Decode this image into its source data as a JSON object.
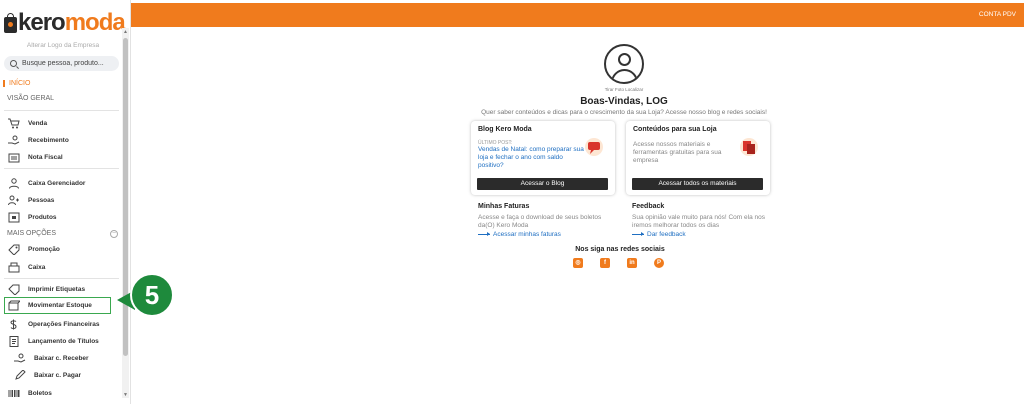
{
  "brand": {
    "word1": "kero",
    "word2": "moda",
    "alter_logo": "Alterar Logo da Empresa"
  },
  "search": {
    "placeholder": "Busque pessoa, produto..."
  },
  "colors": {
    "accent": "#f07b1d",
    "dark": "#2b2b2b",
    "link": "#1f6fc2",
    "highlight": "#3aa84f",
    "badge": "#1e8a3c"
  },
  "sidebar": {
    "inicio": "INÍCIO",
    "visao_geral": "VISÃO GERAL",
    "mais_opcoes": "MAIS OPÇÕES",
    "items": [
      {
        "label": "Venda",
        "icon": "cart-icon"
      },
      {
        "label": "Recebimento",
        "icon": "hand-coin-icon"
      },
      {
        "label": "Nota Fiscal",
        "icon": "invoice-icon"
      },
      {
        "label": "Caixa Gerenciador",
        "icon": "person-icon"
      },
      {
        "label": "Pessoas",
        "icon": "people-icon"
      },
      {
        "label": "Produtos",
        "icon": "box-icon"
      },
      {
        "label": "Promoção",
        "icon": "tag-icon"
      },
      {
        "label": "Caixa",
        "icon": "cash-register-icon"
      },
      {
        "label": "Imprimir Etiquetas",
        "icon": "label-icon"
      },
      {
        "label": "Movimentar Estoque",
        "icon": "stock-icon"
      },
      {
        "label": "Operações Financeiras",
        "icon": "dollar-icon"
      },
      {
        "label": "Lançamento de Títulos",
        "icon": "document-icon"
      },
      {
        "label": "Baixar c. Receber",
        "icon": "hand-coin-icon"
      },
      {
        "label": "Baixar c. Pagar",
        "icon": "pen-icon"
      },
      {
        "label": "Boletos",
        "icon": "barcode-icon"
      }
    ]
  },
  "step_badge": "5",
  "topbar": {
    "account": "CONTA PDV"
  },
  "main": {
    "photo_actions": "Tirar Foto  Localizar",
    "welcome": "Boas-Vindas, LOG",
    "subtitle": "Quer saber conteúdos e dicas para o crescimento da sua Loja? Acesse nosso blog e redes sociais!",
    "blog": {
      "title": "Blog Kero Moda",
      "ultimo": "ÚLTIMO POST:",
      "post": "Vendas de Natal: como preparar sua loja e fechar o ano com saldo positivo?",
      "button": "Acessar o Blog"
    },
    "conteudos": {
      "title": "Conteúdos para sua Loja",
      "desc": "Acesse nossos materiais e ferramentas gratuitas para sua empresa",
      "button": "Acessar todos os materiais"
    },
    "faturas": {
      "title": "Minhas Faturas",
      "desc": "Acesse e faça o download de seus boletos da(O) Kero Moda",
      "link": "Acessar minhas faturas"
    },
    "feedback": {
      "title": "Feedback",
      "desc": "Sua opinião vale muito para nós! Com ela nos iremos melhorar todos os dias",
      "link": "Dar feedback"
    },
    "social_title": "Nos siga nas redes sociais",
    "social": [
      {
        "name": "instagram-icon",
        "glyph": "◎"
      },
      {
        "name": "facebook-icon",
        "glyph": "f"
      },
      {
        "name": "linkedin-icon",
        "glyph": "in"
      },
      {
        "name": "pinterest-icon",
        "glyph": "P"
      }
    ]
  }
}
